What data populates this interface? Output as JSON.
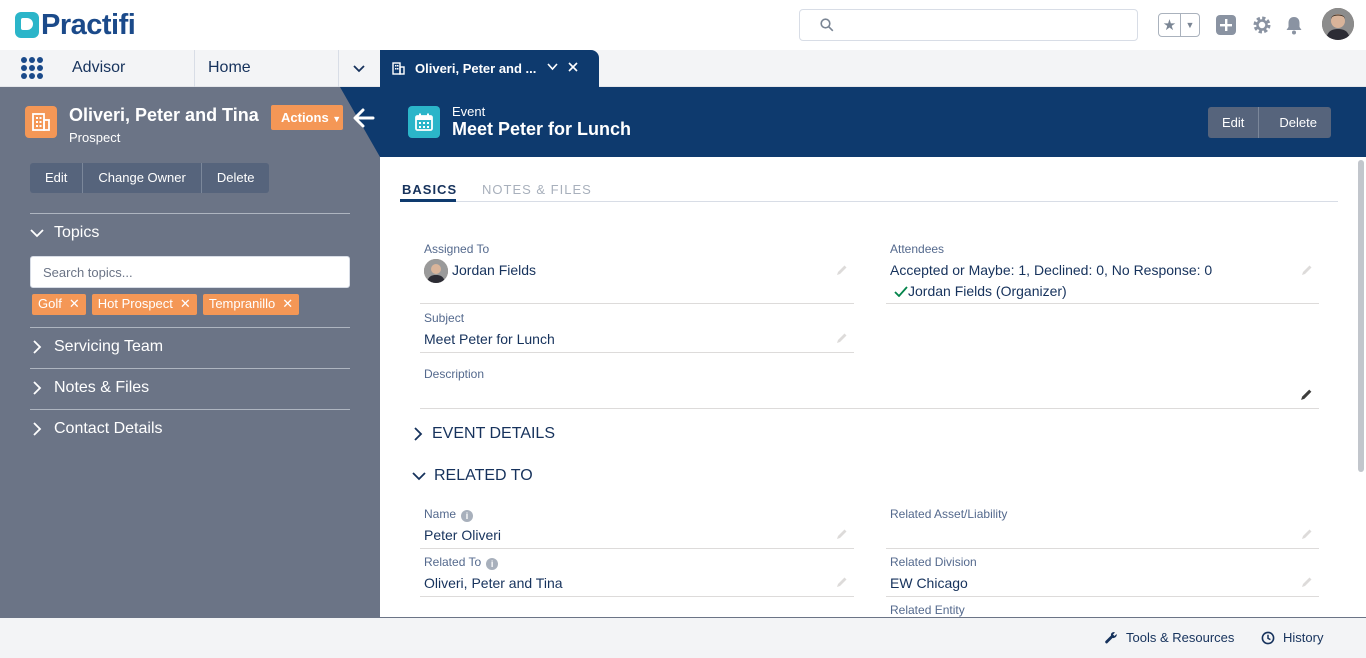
{
  "header": {
    "logo_text": "Practifi",
    "search_placeholder": ""
  },
  "nav": {
    "app_name": "Advisor",
    "home_label": "Home",
    "active_tab_label": "Oliveri, Peter and ..."
  },
  "account": {
    "name": "Oliveri, Peter and Tina",
    "type": "Prospect",
    "actions_label": "Actions",
    "buttons": [
      "Edit",
      "Change Owner",
      "Delete"
    ],
    "topics_label": "Topics",
    "topics_placeholder": "Search topics...",
    "topics": [
      "Golf",
      "Hot Prospect",
      "Tempranillo"
    ],
    "sections": [
      "Servicing Team",
      "Notes & Files",
      "Contact Details"
    ]
  },
  "event": {
    "type_label": "Event",
    "title": "Meet Peter for Lunch",
    "buttons": [
      "Edit",
      "Delete"
    ],
    "tabs": [
      "BASICS",
      "NOTES & FILES"
    ],
    "fields": {
      "assigned_to_label": "Assigned To",
      "assigned_to_value": "Jordan Fields",
      "attendees_label": "Attendees",
      "attendees_value": "Accepted or Maybe: 1, Declined: 0, No Response: 0",
      "attendee_organizer": "Jordan Fields (Organizer)",
      "subject_label": "Subject",
      "subject_value": "Meet Peter for Lunch",
      "description_label": "Description",
      "description_value": ""
    },
    "sections": {
      "event_details": "EVENT DETAILS",
      "related_to": "RELATED TO"
    },
    "related": {
      "name_label": "Name",
      "name_value": "Peter Oliveri",
      "related_to_label": "Related To",
      "related_to_value": "Oliveri, Peter and Tina",
      "asset_label": "Related Asset/Liability",
      "asset_value": "",
      "division_label": "Related Division",
      "division_value": "EW Chicago",
      "entity_label": "Related Entity"
    }
  },
  "footer": {
    "tools_label": "Tools & Resources",
    "history_label": "History"
  },
  "colors": {
    "brand_navy": "#0e3a6e",
    "accent_orange": "#f49756",
    "teal": "#2bb5c9",
    "panel_gray": "#6b7486"
  }
}
